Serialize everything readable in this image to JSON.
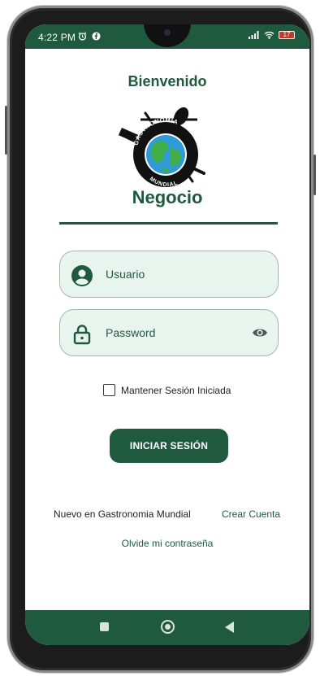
{
  "status_bar": {
    "time": "4:22 PM",
    "left_icons": [
      "alarm-icon",
      "facebook-icon"
    ],
    "right_icons": [
      "signal-icon",
      "wifi-icon",
      "battery-icon"
    ],
    "battery_level": "17"
  },
  "header": {
    "welcome": "Bienvenido",
    "logo_text_top": "GASTRONOMIA",
    "logo_text_bottom": "MUNDIAL",
    "brand": "Negocio"
  },
  "form": {
    "username": {
      "label": "Usuario",
      "icon": "user-circle-icon"
    },
    "password": {
      "label": "Password",
      "icon": "lock-icon",
      "toggle_icon": "eye-icon"
    },
    "remember": {
      "label": "Mantener Sesión Iniciada",
      "checked": false
    },
    "submit_label": "INICIAR SESIÓN"
  },
  "footer": {
    "new_user_text": "Nuevo en Gastronomia Mundial",
    "create_account_label": "Crear Cuenta",
    "forgot_password_label": "Olvide mi contraseña"
  },
  "nav_bar": {
    "buttons": [
      "recents-square-icon",
      "home-circle-icon",
      "back-triangle-icon"
    ]
  },
  "colors": {
    "primary": "#1f5a3f",
    "field_bg": "#e8f4ee",
    "text_dark": "#222222"
  }
}
